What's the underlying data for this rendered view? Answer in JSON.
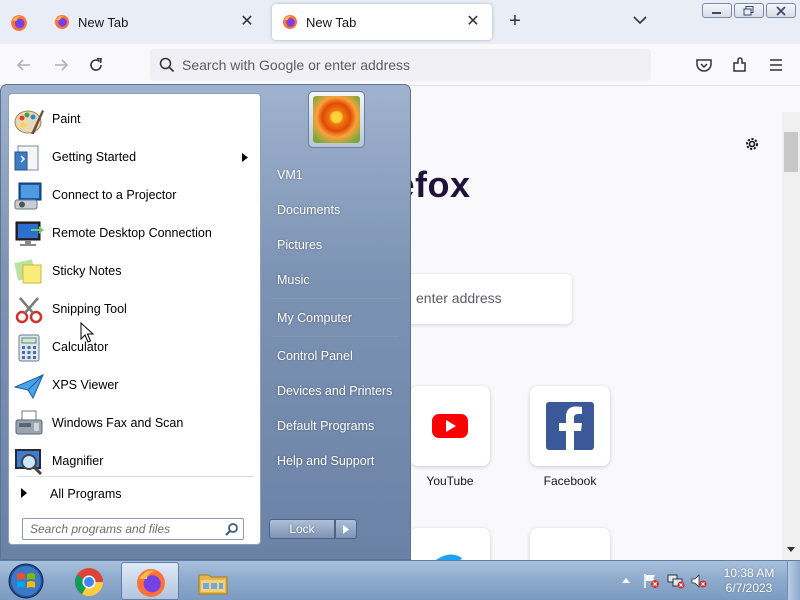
{
  "browser": {
    "tabs": [
      {
        "label": "New Tab",
        "active": false
      },
      {
        "label": "New Tab",
        "active": true
      }
    ],
    "url_placeholder": "Search with Google or enter address",
    "brand_partial": "refox",
    "content_search_partial": "enter address",
    "shortcuts": [
      {
        "label": "YouTube",
        "icon": "youtube-icon"
      },
      {
        "label": "Facebook",
        "icon": "facebook-icon"
      }
    ]
  },
  "start_menu": {
    "programs": [
      {
        "label": "Paint",
        "icon": "paint-icon",
        "has_submenu": false
      },
      {
        "label": "Getting Started",
        "icon": "getting-started-icon",
        "has_submenu": true
      },
      {
        "label": "Connect to a Projector",
        "icon": "projector-icon",
        "has_submenu": false
      },
      {
        "label": "Remote Desktop Connection",
        "icon": "remote-desktop-icon",
        "has_submenu": false
      },
      {
        "label": "Sticky Notes",
        "icon": "sticky-notes-icon",
        "has_submenu": false
      },
      {
        "label": "Snipping Tool",
        "icon": "snipping-tool-icon",
        "has_submenu": false
      },
      {
        "label": "Calculator",
        "icon": "calculator-icon",
        "has_submenu": false
      },
      {
        "label": "XPS Viewer",
        "icon": "xps-viewer-icon",
        "has_submenu": false
      },
      {
        "label": "Windows Fax and Scan",
        "icon": "fax-scan-icon",
        "has_submenu": false
      },
      {
        "label": "Magnifier",
        "icon": "magnifier-icon",
        "has_submenu": false
      }
    ],
    "all_programs": "All Programs",
    "search_placeholder": "Search programs and files",
    "right_links": {
      "user": "VM1",
      "documents": "Documents",
      "pictures": "Pictures",
      "music": "Music",
      "computer": "My Computer",
      "control_panel": "Control Panel",
      "devices": "Devices and Printers",
      "default_programs": "Default Programs",
      "help": "Help and Support"
    },
    "lock_label": "Lock"
  },
  "taskbar": {
    "pinned": [
      "chrome-icon",
      "firefox-icon",
      "explorer-icon"
    ],
    "time": "10:38 AM",
    "date": "6/7/2023"
  },
  "colors": {
    "taskbar": "#8fabcd",
    "start_menu": "#7d93b4",
    "youtube_red": "#ff0000",
    "facebook_blue": "#1877f2"
  }
}
